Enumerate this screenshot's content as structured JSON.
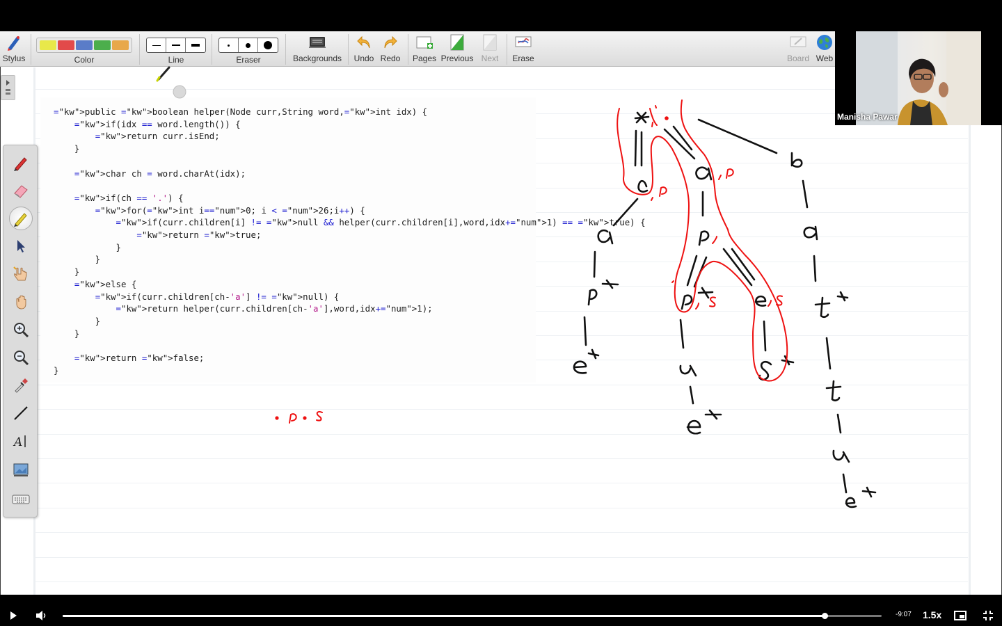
{
  "toolbar": {
    "stylus": "Stylus",
    "color": "Color",
    "line": "Line",
    "eraser": "Eraser",
    "backgrounds": "Backgrounds",
    "undo": "Undo",
    "redo": "Redo",
    "pages": "Pages",
    "previous": "Previous",
    "next": "Next",
    "erase": "Erase",
    "board": "Board",
    "web": "Web",
    "swatch_colors": [
      "#e8e84a",
      "#e24a4a",
      "#5a7cc8",
      "#4cae4c",
      "#e8a84a"
    ]
  },
  "sidebar": {
    "tools": [
      "red-pen-icon",
      "highlighter-eraser-icon",
      "yellow-highlighter-icon",
      "select-arrow-icon",
      "pointer-hand-icon",
      "pan-hand-icon",
      "zoom-in-icon",
      "zoom-out-icon",
      "eyedropper-icon",
      "line-tool-icon",
      "text-tool-icon",
      "screen-capture-icon",
      "keyboard-icon"
    ]
  },
  "code": {
    "lines": [
      "public boolean helper(Node curr,String word,int idx) {",
      "    if(idx == word.length()) {",
      "        return curr.isEnd;",
      "    }",
      "",
      "    char ch = word.charAt(idx);",
      "",
      "    if(ch == '.') {",
      "        for(int i=0; i < 26;i++) {",
      "            if(curr.children[i] != null && helper(curr.children[i],word,idx+1) == true) {",
      "                return true;",
      "            }",
      "        }",
      "    }",
      "    else {",
      "        if(curr.children[ch-'a'] != null) {",
      "            return helper(curr.children[ch-'a'],word,idx+1);",
      "        }",
      "    }",
      "",
      "    return false;",
      "}"
    ]
  },
  "annotations": {
    "search_word": ". p . s",
    "trie_letters": [
      "*",
      "c",
      "a",
      "b",
      "a",
      "p",
      "a",
      "p",
      "e",
      "s",
      "t",
      "e",
      "u",
      "t",
      "e",
      "u",
      "e"
    ],
    "red_labels": [
      ", p",
      ", p",
      ", s",
      ", s",
      ","
    ]
  },
  "webcam": {
    "presenter_name": "Manisha Pawar"
  },
  "player": {
    "time_remaining": "-9:07",
    "speed": "1.5x",
    "progress": 0.93
  }
}
